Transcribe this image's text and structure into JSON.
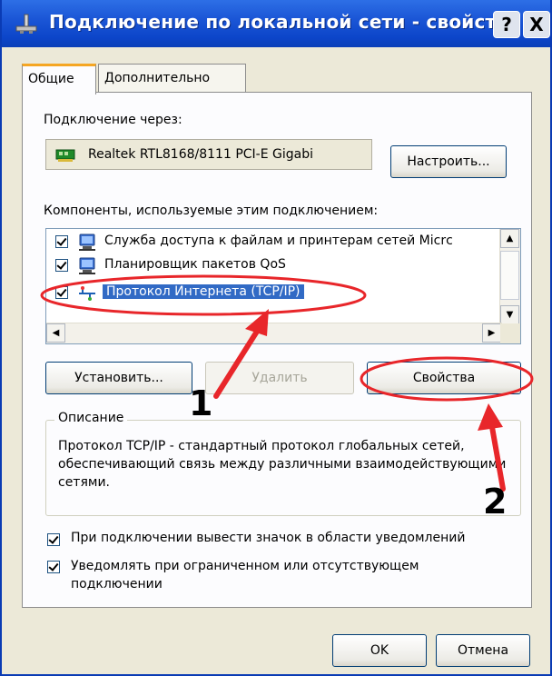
{
  "window": {
    "title": "Подключение по локальной сети - свойства",
    "help_label": "?",
    "close_label": "X"
  },
  "tabs": [
    {
      "label": "Общие",
      "active": true
    },
    {
      "label": "Дополнительно",
      "active": false
    }
  ],
  "connect_via": {
    "label": "Подключение через:",
    "adapter_name": "Realtek RTL8168/8111 PCI-E Gigabi",
    "configure_button": "Настроить..."
  },
  "components": {
    "label": "Компоненты, используемые этим подключением:",
    "items": [
      {
        "label": "Служба доступа к файлам и принтерам сетей Micrс",
        "checked": true,
        "icon": "network-service-icon",
        "selected": false
      },
      {
        "label": "Планировщик пакетов QoS",
        "checked": true,
        "icon": "network-service-icon",
        "selected": false
      },
      {
        "label": "Протокол Интернета (TCP/IP)",
        "checked": true,
        "icon": "protocol-icon",
        "selected": true
      }
    ]
  },
  "actions": {
    "install": "Установить...",
    "remove": "Удалить",
    "properties": "Свойства"
  },
  "description": {
    "title": "Описание",
    "text": "Протокол TCP/IP - стандартный протокол глобальных сетей, обеспечивающий связь между различными взаимодействующими сетями."
  },
  "options": {
    "show_icon": "При подключении вывести значок в области уведомлений",
    "notify": "Уведомлять при ограниченном или отсутствующем подключении"
  },
  "footer": {
    "ok": "OK",
    "cancel": "Отмена"
  },
  "annotations": {
    "step1": "1",
    "step2": "2",
    "highlight_color": "#e8262a",
    "arrow_color": "#e8262a"
  }
}
